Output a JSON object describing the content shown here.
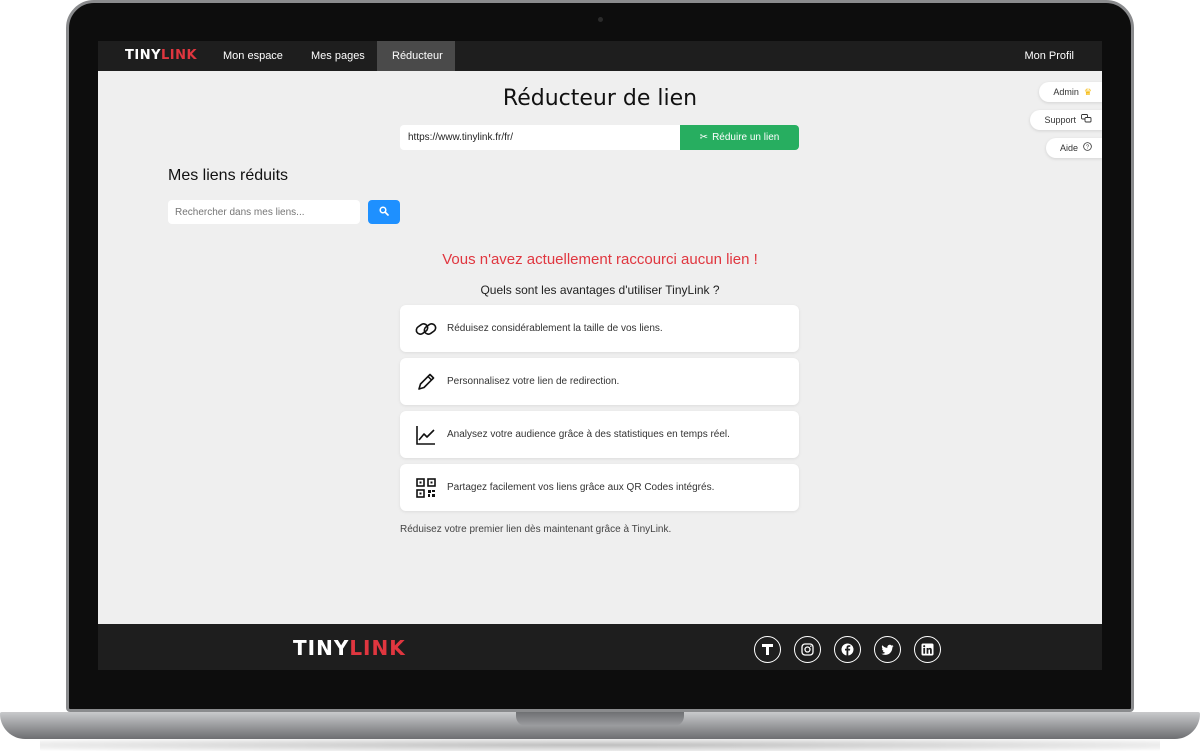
{
  "brand": {
    "tiny": "TINY",
    "link": "LINK"
  },
  "nav": {
    "items": [
      {
        "label": "Mon espace"
      },
      {
        "label": "Mes pages"
      },
      {
        "label": "Réducteur"
      }
    ],
    "active": "Réducteur",
    "profile": "Mon Profil"
  },
  "side_menu": {
    "admin": "Admin",
    "support": "Support",
    "help": "Aide"
  },
  "shortener": {
    "title": "Réducteur de lien",
    "url_value": "https://www.tinylink.fr/fr/",
    "button_label": "Réduire un lien"
  },
  "my_links": {
    "title": "Mes liens réduits",
    "search_placeholder": "Rechercher dans mes liens..."
  },
  "empty_state": {
    "message": "Vous n'avez actuellement raccourci aucun lien !",
    "advantages_title": "Quels sont les avantages d'utiliser TinyLink ?",
    "advantages": [
      {
        "icon": "link-icon",
        "text": "Réduisez considérablement la taille de vos liens."
      },
      {
        "icon": "pencil-icon",
        "text": "Personnalisez votre lien de redirection."
      },
      {
        "icon": "chart-icon",
        "text": "Analysez votre audience grâce à des statistiques en temps réel."
      },
      {
        "icon": "qr-code-icon",
        "text": "Partagez facilement vos liens grâce aux QR Codes intégrés."
      }
    ],
    "cta": "Réduisez votre premier lien dès maintenant grâce à TinyLink."
  },
  "footer": {
    "brand_tiny": "TINY",
    "brand_link": "LINK",
    "socials": [
      "tinylink-icon",
      "instagram-icon",
      "facebook-icon",
      "twitter-icon",
      "linkedin-icon"
    ]
  },
  "colors": {
    "brand_red": "#e0363f",
    "primary_green": "#27ae60",
    "primary_blue": "#1e90ff",
    "nav_dark": "#1e1e1e"
  }
}
